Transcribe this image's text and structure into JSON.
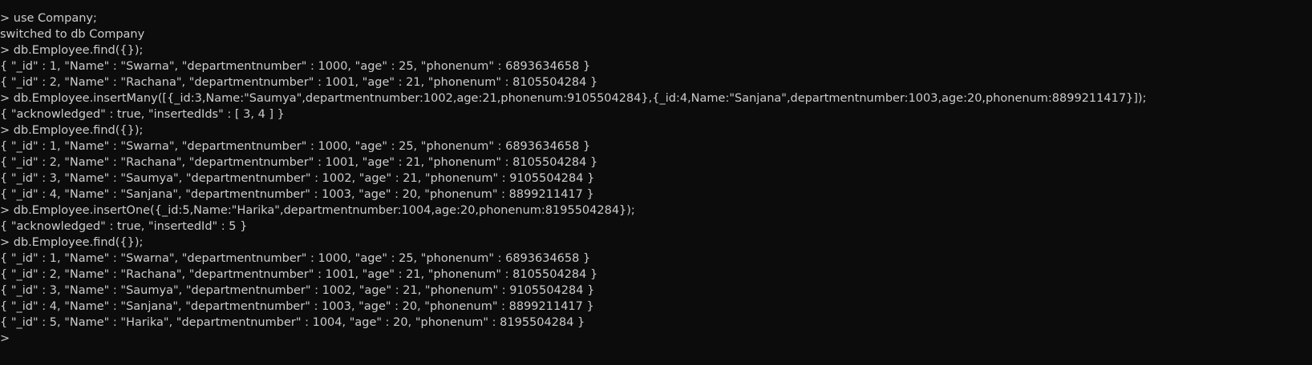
{
  "colors": {
    "background": "#0c0c0c",
    "foreground": "#cccccc"
  },
  "terminal": {
    "lines": [
      "> use Company;",
      "switched to db Company",
      "> db.Employee.find({});",
      "{ \"_id\" : 1, \"Name\" : \"Swarna\", \"departmentnumber\" : 1000, \"age\" : 25, \"phonenum\" : 6893634658 }",
      "{ \"_id\" : 2, \"Name\" : \"Rachana\", \"departmentnumber\" : 1001, \"age\" : 21, \"phonenum\" : 8105504284 }",
      "> db.Employee.insertMany([{_id:3,Name:\"Saumya\",departmentnumber:1002,age:21,phonenum:9105504284},{_id:4,Name:\"Sanjana\",departmentnumber:1003,age:20,phonenum:8899211417}]);",
      "{ \"acknowledged\" : true, \"insertedIds\" : [ 3, 4 ] }",
      "> db.Employee.find({});",
      "{ \"_id\" : 1, \"Name\" : \"Swarna\", \"departmentnumber\" : 1000, \"age\" : 25, \"phonenum\" : 6893634658 }",
      "{ \"_id\" : 2, \"Name\" : \"Rachana\", \"departmentnumber\" : 1001, \"age\" : 21, \"phonenum\" : 8105504284 }",
      "{ \"_id\" : 3, \"Name\" : \"Saumya\", \"departmentnumber\" : 1002, \"age\" : 21, \"phonenum\" : 9105504284 }",
      "{ \"_id\" : 4, \"Name\" : \"Sanjana\", \"departmentnumber\" : 1003, \"age\" : 20, \"phonenum\" : 8899211417 }",
      "> db.Employee.insertOne({_id:5,Name:\"Harika\",departmentnumber:1004,age:20,phonenum:8195504284});",
      "{ \"acknowledged\" : true, \"insertedId\" : 5 }",
      "> db.Employee.find({});",
      "{ \"_id\" : 1, \"Name\" : \"Swarna\", \"departmentnumber\" : 1000, \"age\" : 25, \"phonenum\" : 6893634658 }",
      "{ \"_id\" : 2, \"Name\" : \"Rachana\", \"departmentnumber\" : 1001, \"age\" : 21, \"phonenum\" : 8105504284 }",
      "{ \"_id\" : 3, \"Name\" : \"Saumya\", \"departmentnumber\" : 1002, \"age\" : 21, \"phonenum\" : 9105504284 }",
      "{ \"_id\" : 4, \"Name\" : \"Sanjana\", \"departmentnumber\" : 1003, \"age\" : 20, \"phonenum\" : 8899211417 }",
      "{ \"_id\" : 5, \"Name\" : \"Harika\", \"departmentnumber\" : 1004, \"age\" : 20, \"phonenum\" : 8195504284 }"
    ],
    "prompt": ">"
  }
}
